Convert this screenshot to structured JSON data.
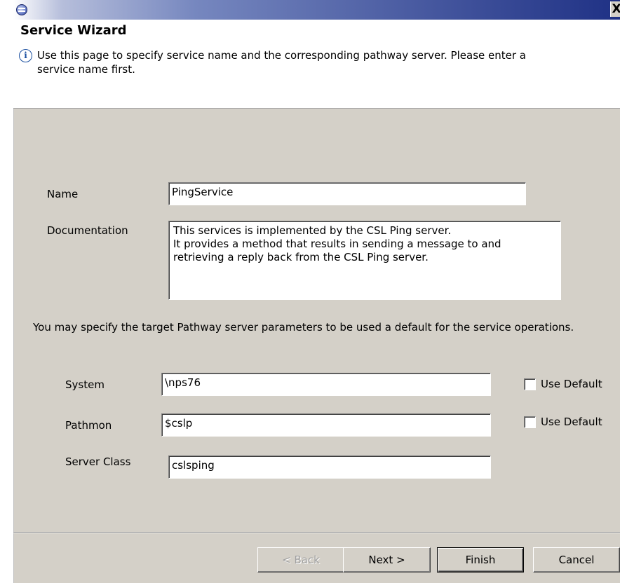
{
  "titlebar": {
    "icon": "eclipse-app-icon",
    "close_label": "X"
  },
  "header": {
    "title": "Service Wizard",
    "description": "Use this page to specify service name and the corresponding pathway server. Please enter a service name first.",
    "info_icon": "info-icon"
  },
  "form": {
    "name_label": "Name",
    "name_value": "PingService",
    "documentation_label": "Documentation",
    "documentation_value": "This services is implemented by the CSL Ping server.\nIt provides a method that results in sending a message to and\nretrieving a reply back from the CSL Ping server.",
    "pathway_hint": "You may specify the target Pathway server parameters to be used a default for the service operations.",
    "system_label": "System",
    "system_value": "\\nps76",
    "system_use_default_label": "Use Default",
    "pathmon_label": "Pathmon",
    "pathmon_value": "$cslp",
    "pathmon_use_default_label": "Use Default",
    "server_class_label": "Server Class",
    "server_class_value": "cslsping"
  },
  "buttons": {
    "back": "< Back",
    "next": "Next >",
    "finish": "Finish",
    "cancel": "Cancel"
  }
}
